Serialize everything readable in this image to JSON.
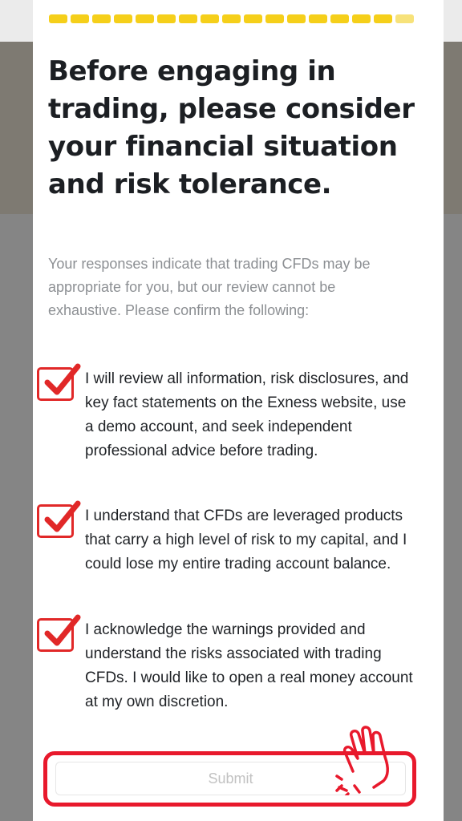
{
  "progress": {
    "segments": 17
  },
  "headline": "Before engaging in trading, please consider your financial situation and risk tolerance.",
  "intro": "Your responses indicate that trading CFDs may be appropriate for you, but our review cannot be exhaustive. Please confirm the following:",
  "checklist": [
    {
      "label": "I will review all information, risk disclosures, and key fact statements on the Exness website, use a demo account, and seek independent professional advice before trading.",
      "checked": true
    },
    {
      "label": "I understand that CFDs are leveraged products that carry a high level of risk to my capital, and I could lose my entire trading account balance.",
      "checked": true
    },
    {
      "label": "I acknowledge the warnings provided and understand the risks associated with trading CFDs. I would like to open a real money account at my own discretion.",
      "checked": true
    }
  ],
  "submit_label": "Submit",
  "colors": {
    "accent": "#f5cf1a",
    "highlight": "#e8192c",
    "text": "#1c1f23",
    "muted": "#8c8f93"
  }
}
